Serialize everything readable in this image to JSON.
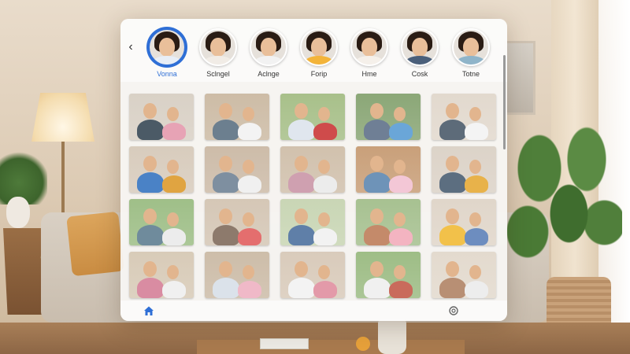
{
  "people": [
    {
      "name": "Vonna",
      "selected": true,
      "shirt": "#e8eef6"
    },
    {
      "name": "Sclngel",
      "selected": false,
      "shirt": "#f1ece6"
    },
    {
      "name": "Aclnge",
      "selected": false,
      "shirt": "#f2f2f2"
    },
    {
      "name": "Forip",
      "selected": false,
      "shirt": "#f3b43a"
    },
    {
      "name": "Hme",
      "selected": false,
      "shirt": "#f5f0ea"
    },
    {
      "name": "Cosk",
      "selected": false,
      "shirt": "#4a5f7a"
    },
    {
      "name": "Totne",
      "selected": false,
      "shirt": "#8fb4c9"
    }
  ],
  "colors": {
    "accent": "#2f6fd6"
  },
  "icons": {
    "back": "chevron-left-icon",
    "home": "home-icon",
    "settings": "settings-icon"
  },
  "photos": [
    {
      "bg": "#d9d1c6",
      "a": "#4b5a66",
      "b": "#e7a3b5"
    },
    {
      "bg": "#cdbca6",
      "a": "#6c7f8f",
      "b": "#f3f3f3"
    },
    {
      "bg": "#a8c08a",
      "a": "#e0e6ee",
      "b": "#cf4b4b"
    },
    {
      "bg": "#8ba777",
      "a": "#6f7f95",
      "b": "#6aa6d8"
    },
    {
      "bg": "#e2d9ce",
      "a": "#5d6b79",
      "b": "#f4f4f4"
    },
    {
      "bg": "#d8ccbd",
      "a": "#4a82c6",
      "b": "#e0a441"
    },
    {
      "bg": "#cdbca9",
      "a": "#7e8fa0",
      "b": "#f0f0f0"
    },
    {
      "bg": "#d1c1ad",
      "a": "#cfa0b0",
      "b": "#ececec"
    },
    {
      "bg": "#c9a07a",
      "a": "#6e93b8",
      "b": "#f3c7d6"
    },
    {
      "bg": "#dcd3c8",
      "a": "#5c6e80",
      "b": "#e8b24a"
    },
    {
      "bg": "#9fbf88",
      "a": "#6f8b9c",
      "b": "#ececec"
    },
    {
      "bg": "#d5c7b6",
      "a": "#8d7a6c",
      "b": "#e46e6e"
    },
    {
      "bg": "#c9d6b5",
      "a": "#5f7fa8",
      "b": "#f2f2f2"
    },
    {
      "bg": "#a7c191",
      "a": "#c48a6a",
      "b": "#f3b4c1"
    },
    {
      "bg": "#e0d6ca",
      "a": "#f2c14a",
      "b": "#6d8dbf"
    },
    {
      "bg": "#d8cbb8",
      "a": "#d98ca2",
      "b": "#f0f0f0"
    },
    {
      "bg": "#cdbda9",
      "a": "#dbe2ea",
      "b": "#f0b9c8"
    },
    {
      "bg": "#d9cbbb",
      "a": "#f3f3f3",
      "b": "#e39aa9"
    },
    {
      "bg": "#9ebd86",
      "a": "#f0f0f0",
      "b": "#c96b5c"
    },
    {
      "bg": "#e3dace",
      "a": "#b88f74",
      "b": "#ededed"
    }
  ]
}
